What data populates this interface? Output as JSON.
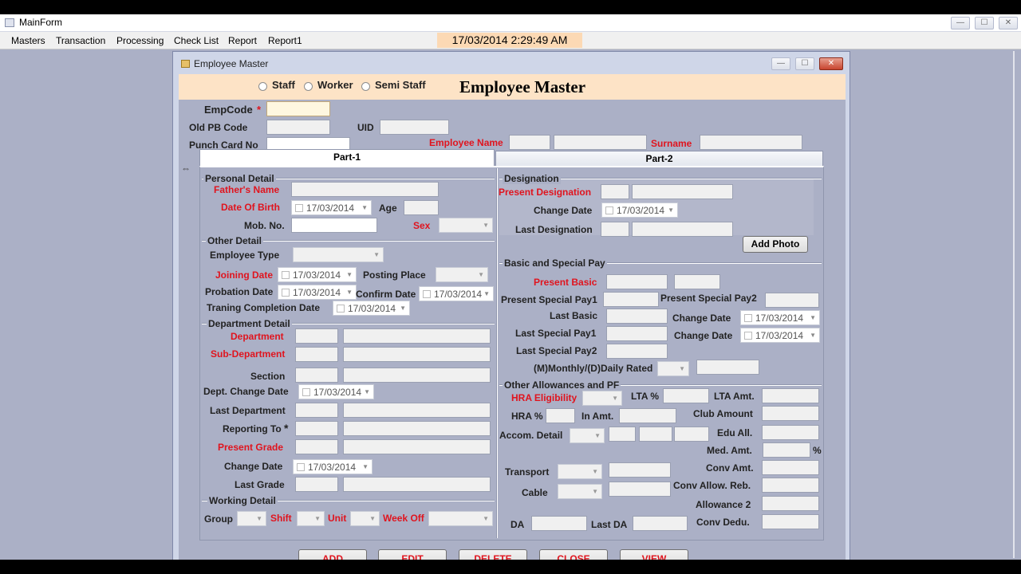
{
  "window": {
    "title": "MainForm",
    "min": "—",
    "max": "☐",
    "close": "✕"
  },
  "menu": [
    "Masters",
    "Transaction",
    "Processing",
    "Check List",
    "Report",
    "Report1"
  ],
  "clock": "17/03/2014 2:29:49 AM",
  "child": {
    "title": "Employee Master"
  },
  "header": {
    "radios": [
      "Staff",
      "Worker",
      "Semi Staff"
    ],
    "title": "Employee  Master"
  },
  "top": {
    "empcode": "EmpCode",
    "star": "*",
    "oldpb": "Old PB Code",
    "uid": "UID",
    "punch": "Punch Card No",
    "empname": "Employee Name",
    "surname": "Surname"
  },
  "tabs": [
    "Part-1",
    "Part-2"
  ],
  "date": "17/03/2014",
  "personal": {
    "group": "Personal Detail",
    "father": "Father's Name",
    "dob": "Date Of Birth",
    "age": "Age",
    "mob": "Mob. No.",
    "sex": "Sex"
  },
  "other": {
    "group": "Other Detail",
    "emptype": "Employee Type",
    "joining": "Joining Date",
    "posting": "Posting Place",
    "probation": "Probation Date",
    "confirm": "Confirm Date",
    "training": "Traning Completion Date"
  },
  "dept": {
    "group": "Department Detail",
    "department": "Department",
    "subdept": "Sub-Department",
    "section": "Section",
    "deptchange": "Dept. Change Date",
    "lastdept": "Last Department",
    "reporting": "Reporting To",
    "star": "*",
    "grade": "Present Grade",
    "change": "Change Date",
    "lastgrade": "Last Grade"
  },
  "working": {
    "group": "Working Detail",
    "group_lbl": "Group",
    "shift": "Shift",
    "unit": "Unit",
    "weekoff": "Week Off"
  },
  "designation": {
    "group": "Designation",
    "present": "Present Designation",
    "change": "Change Date",
    "last": "Last Designation",
    "photo": "Add Photo"
  },
  "pay": {
    "group": "Basic and Special Pay",
    "basic": "Present Basic",
    "sp1": "Present Special Pay1",
    "sp2": "Present Special Pay2",
    "lastbasic": "Last Basic",
    "change1": "Change Date",
    "lsp1": "Last Special Pay1",
    "change2": "Change Date",
    "lsp2": "Last Special Pay2",
    "rated": "(M)Monthly/(D)Daily Rated"
  },
  "allow": {
    "group": "Other Allowances and PF",
    "hra": "HRA Eligibility",
    "lta": "LTA %",
    "ltaamt": "LTA Amt.",
    "hrap": "HRA %",
    "inamt": "In Amt.",
    "club": "Club Amount",
    "accom": "Accom. Detail",
    "edu": "Edu All.",
    "med": "Med. Amt.",
    "pct": "%",
    "transport": "Transport",
    "conv": "Conv Amt.",
    "cable": "Cable",
    "convreb": "Conv Allow. Reb.",
    "allow2": "Allowance 2",
    "da": "DA",
    "lastda": "Last DA",
    "convded": "Conv Dedu."
  },
  "buttons": [
    "ADD",
    "EDIT",
    "DELETE",
    "CLOSE",
    "VIEW"
  ]
}
